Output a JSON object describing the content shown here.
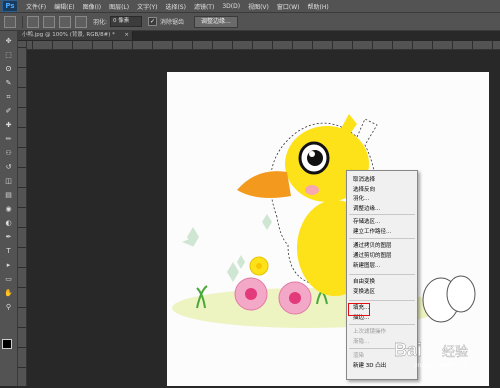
{
  "app": {
    "logo": "Ps"
  },
  "menubar": {
    "items": [
      "文件(F)",
      "编辑(E)",
      "图像(I)",
      "图层(L)",
      "文字(Y)",
      "选择(S)",
      "滤镜(T)",
      "3D(D)",
      "视图(V)",
      "窗口(W)",
      "帮助(H)"
    ]
  },
  "options": {
    "feather_label": "羽化:",
    "feather_value": "0 像素",
    "antialias_label": "消除锯齿",
    "antialias_checked": "✓",
    "refine_edge_label": "调整边缘..."
  },
  "document": {
    "tab_title": "小鸭.jpg @ 100% (背景, RGB/8#) *",
    "tab_close": "×"
  },
  "tools": {
    "icons": [
      "move-icon",
      "marquee-icon",
      "lasso-icon",
      "quick-select-icon",
      "crop-icon",
      "eyedropper-icon",
      "healing-icon",
      "brush-icon",
      "stamp-icon",
      "history-brush-icon",
      "eraser-icon",
      "gradient-icon",
      "blur-icon",
      "dodge-icon",
      "pen-icon",
      "type-icon",
      "path-select-icon",
      "shape-icon",
      "hand-icon",
      "zoom-icon"
    ],
    "glyphs": [
      "✥",
      "⬚",
      "ʘ",
      "✎",
      "⌗",
      "✐",
      "✚",
      "✏",
      "⚇",
      "↺",
      "◫",
      "▤",
      "◉",
      "◐",
      "✒",
      "T",
      "▸",
      "▭",
      "✋",
      "⚲"
    ]
  },
  "context_menu": {
    "items": [
      {
        "label": "取消选择",
        "enabled": true
      },
      {
        "label": "选择反向",
        "enabled": true
      },
      {
        "label": "羽化...",
        "enabled": true
      },
      {
        "label": "调整边缘...",
        "enabled": true
      },
      {
        "label": "存储选区...",
        "enabled": true
      },
      {
        "label": "建立工作路径...",
        "enabled": true
      },
      {
        "label": "通过拷贝的图层",
        "enabled": true
      },
      {
        "label": "通过剪切的图层",
        "enabled": true
      },
      {
        "label": "新建图层...",
        "enabled": true
      },
      {
        "label": "自由变换",
        "enabled": true
      },
      {
        "label": "变换选区",
        "enabled": true
      },
      {
        "label": "填充...",
        "enabled": true,
        "highlighted": true
      },
      {
        "label": "描边...",
        "enabled": true
      },
      {
        "label": "上次滤镜操作",
        "enabled": false
      },
      {
        "label": "渐隐...",
        "enabled": false
      },
      {
        "label": "渲染",
        "enabled": false
      },
      {
        "label": "新建 3D 凸出",
        "enabled": true
      }
    ],
    "highlight_color": "#e01010"
  },
  "watermark": {
    "text": "Bai",
    "text2": "经验",
    "url": "jingyan.baidu.com"
  },
  "colors": {
    "workspace": "#282828",
    "panel": "#535353",
    "duck": "#fde21a",
    "beak": "#f39a1e"
  }
}
